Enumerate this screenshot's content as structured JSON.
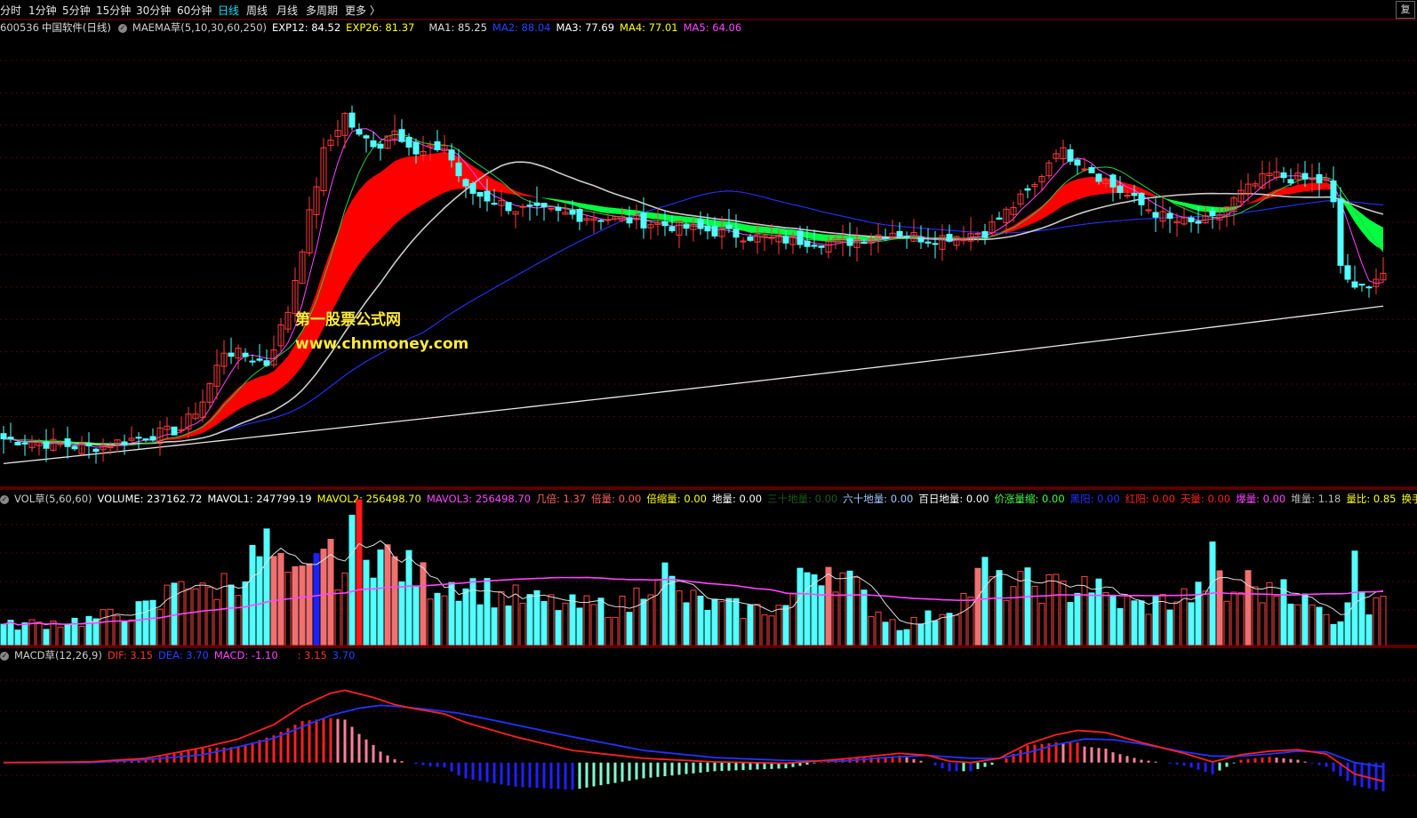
{
  "topbar": {
    "tabs": [
      "分时",
      "1分钟",
      "5分钟",
      "15分钟",
      "30分钟",
      "60分钟",
      "日线",
      "周线",
      "月线",
      "多周期"
    ],
    "active_tab": "日线",
    "more": "更多 〉",
    "corner_label": "复"
  },
  "main_info": {
    "code": "600536",
    "name": "中国软件(日线)",
    "indicator": "MAEMA草(5,10,30,60,250)",
    "exp12": "EXP12: 84.52",
    "exp26": "EXP26: 81.37",
    "ma1": "MA1: 85.25",
    "ma2": "MA2: 88.04",
    "ma3": "MA3: 77.69",
    "ma4": "MA4: 77.01",
    "ma5": "MA5: 64.06"
  },
  "watermark": {
    "line1": "第一股票公式网",
    "line2": "www.chnmoney.com"
  },
  "vol_info": {
    "name": "VOL草(5,60,60)",
    "volume": "VOLUME: 237162.72",
    "mavol1": "MAVOL1: 247799.19",
    "mavol2": "MAVOL2: 256498.70",
    "mavol3": "MAVOL3: 256498.70",
    "jibei": "几倍: 1.37",
    "beiliang": "倍量: 0.00",
    "beisuoliang": "倍缩量: 0.00",
    "diliang": "地量: 0.00",
    "sanshi": "三十地量: 0.00",
    "liushi": "六十地量: 0.00",
    "bairi": "百日地量: 0.00",
    "jiazhang": "价涨量缩: 0.00",
    "heiyang": "黑阳: 0.00",
    "hongyang": "红阳: 0.00",
    "tianliang": "天量: 0.00",
    "baoliang": "爆量: 0.00",
    "duiliang": "堆量: 1.18",
    "liangbi": "量比: 0.85",
    "huanshou": "换手率"
  },
  "macd_info": {
    "name": "MACD草(12,26,9)",
    "dif": "DIF: 3.15",
    "dea": "DEA: 3.70",
    "macd": "MACD: -1.10",
    "extra1": ": 3.15",
    "extra2": "3.70"
  },
  "colors": {
    "up": "#ff3a3a",
    "down": "#54ffff",
    "ma5": "#ff44ff",
    "ma10": "#2ecc40",
    "ma30": "#ff0000",
    "ma60": "#dddddd",
    "ma250": "#ffffff",
    "blue": "#2222ff",
    "ribbon_up": "#ff0000",
    "ribbon_down": "#00ff40"
  },
  "chart_data": [
    {
      "type": "candlestick",
      "title": "600536 中国软件(日线)",
      "keyframes": [
        [
          0,
          58.5
        ],
        [
          12,
          57.3
        ],
        [
          25,
          59.8
        ],
        [
          28,
          63.5
        ],
        [
          31,
          70.2
        ],
        [
          34,
          69.5
        ],
        [
          37,
          68.5
        ],
        [
          40,
          75.5
        ],
        [
          43,
          88.2
        ],
        [
          45,
          96.5
        ],
        [
          48,
          101.5
        ],
        [
          50,
          98.5
        ],
        [
          53,
          97.5
        ],
        [
          55,
          100.0
        ],
        [
          58,
          96.0
        ],
        [
          62,
          97.5
        ],
        [
          65,
          91.5
        ],
        [
          72,
          89.0
        ],
        [
          82,
          88.0
        ],
        [
          88,
          87.5
        ],
        [
          100,
          86.0
        ],
        [
          108,
          85.0
        ],
        [
          118,
          84.5
        ],
        [
          125,
          86.0
        ],
        [
          130,
          85.0
        ],
        [
          138,
          86.0
        ],
        [
          145,
          92.0
        ],
        [
          148,
          97.0
        ],
        [
          151,
          95.5
        ],
        [
          156,
          92.0
        ],
        [
          160,
          89.5
        ],
        [
          164,
          87.5
        ],
        [
          167,
          87.0
        ],
        [
          170,
          87.5
        ],
        [
          174,
          91.0
        ],
        [
          178,
          93.5
        ],
        [
          182,
          93.0
        ],
        [
          186,
          92.5
        ],
        [
          187,
          89.5
        ],
        [
          188,
          81.5
        ],
        [
          190,
          78.0
        ],
        [
          194,
          80.5
        ]
      ],
      "ylim": [
        53,
        112
      ]
    },
    {
      "type": "bar",
      "title": "VOL草(5,60,60)",
      "keyframes": [
        [
          0,
          100
        ],
        [
          12,
          130
        ],
        [
          22,
          200
        ],
        [
          25,
          390
        ],
        [
          28,
          260
        ],
        [
          31,
          320
        ],
        [
          34,
          380
        ],
        [
          37,
          500
        ],
        [
          40,
          310
        ],
        [
          43,
          360
        ],
        [
          44,
          560
        ],
        [
          46,
          420
        ],
        [
          48,
          380
        ],
        [
          50,
          680
        ],
        [
          52,
          490
        ],
        [
          55,
          420
        ],
        [
          60,
          320
        ],
        [
          65,
          320
        ],
        [
          70,
          250
        ],
        [
          80,
          200
        ],
        [
          88,
          200
        ],
        [
          92,
          420
        ],
        [
          95,
          250
        ],
        [
          100,
          200
        ],
        [
          105,
          180
        ],
        [
          110,
          200
        ],
        [
          113,
          380
        ],
        [
          116,
          420
        ],
        [
          119,
          320
        ],
        [
          122,
          200
        ],
        [
          126,
          100
        ],
        [
          130,
          140
        ],
        [
          135,
          240
        ],
        [
          138,
          380
        ],
        [
          140,
          300
        ],
        [
          145,
          310
        ],
        [
          150,
          280
        ],
        [
          152,
          350
        ],
        [
          155,
          240
        ],
        [
          160,
          200
        ],
        [
          165,
          240
        ],
        [
          168,
          260
        ],
        [
          170,
          420
        ],
        [
          172,
          240
        ],
        [
          175,
          320
        ],
        [
          178,
          260
        ],
        [
          180,
          340
        ],
        [
          183,
          220
        ],
        [
          186,
          150
        ],
        [
          188,
          140
        ],
        [
          190,
          400
        ],
        [
          192,
          220
        ],
        [
          194,
          320
        ]
      ],
      "ylim": [
        0,
        700
      ]
    },
    {
      "type": "line",
      "title": "MACD草(12,26,9)",
      "dif_keyframes": [
        [
          0,
          0.0
        ],
        [
          12,
          0.1
        ],
        [
          20,
          0.6
        ],
        [
          28,
          2.1
        ],
        [
          33,
          3.3
        ],
        [
          38,
          5.3
        ],
        [
          42,
          7.9
        ],
        [
          46,
          9.7
        ],
        [
          48,
          10.1
        ],
        [
          52,
          9.1
        ],
        [
          55,
          8.1
        ],
        [
          58,
          7.5
        ],
        [
          62,
          6.8
        ],
        [
          65,
          5.6
        ],
        [
          72,
          3.6
        ],
        [
          80,
          1.7
        ],
        [
          90,
          0.6
        ],
        [
          100,
          0.1
        ],
        [
          110,
          -0.1
        ],
        [
          118,
          0.5
        ],
        [
          122,
          0.9
        ],
        [
          126,
          1.3
        ],
        [
          130,
          1.0
        ],
        [
          133,
          0.2
        ],
        [
          136,
          0.0
        ],
        [
          140,
          0.6
        ],
        [
          144,
          2.6
        ],
        [
          148,
          3.9
        ],
        [
          151,
          4.5
        ],
        [
          155,
          4.2
        ],
        [
          160,
          2.8
        ],
        [
          166,
          1.3
        ],
        [
          170,
          0.1
        ],
        [
          174,
          1.1
        ],
        [
          178,
          1.6
        ],
        [
          182,
          1.8
        ],
        [
          186,
          1.2
        ],
        [
          190,
          -1.6
        ],
        [
          194,
          -2.6
        ]
      ],
      "dea_keyframes": [
        [
          0,
          0.0
        ],
        [
          12,
          0.0
        ],
        [
          20,
          0.4
        ],
        [
          28,
          1.1
        ],
        [
          33,
          2.2
        ],
        [
          38,
          3.4
        ],
        [
          42,
          5.0
        ],
        [
          46,
          6.6
        ],
        [
          50,
          7.6
        ],
        [
          53,
          8.0
        ],
        [
          56,
          7.8
        ],
        [
          60,
          7.4
        ],
        [
          64,
          6.9
        ],
        [
          70,
          5.7
        ],
        [
          80,
          3.6
        ],
        [
          90,
          1.7
        ],
        [
          100,
          0.7
        ],
        [
          110,
          0.3
        ],
        [
          118,
          0.2
        ],
        [
          124,
          0.7
        ],
        [
          130,
          1.0
        ],
        [
          136,
          0.6
        ],
        [
          140,
          0.6
        ],
        [
          144,
          1.4
        ],
        [
          148,
          2.5
        ],
        [
          152,
          3.3
        ],
        [
          156,
          3.2
        ],
        [
          160,
          2.6
        ],
        [
          166,
          1.5
        ],
        [
          170,
          0.9
        ],
        [
          174,
          0.9
        ],
        [
          178,
          1.2
        ],
        [
          182,
          1.6
        ],
        [
          186,
          1.5
        ],
        [
          190,
          0.0
        ],
        [
          194,
          -0.6
        ]
      ],
      "ylim": [
        -6,
        14
      ]
    }
  ]
}
